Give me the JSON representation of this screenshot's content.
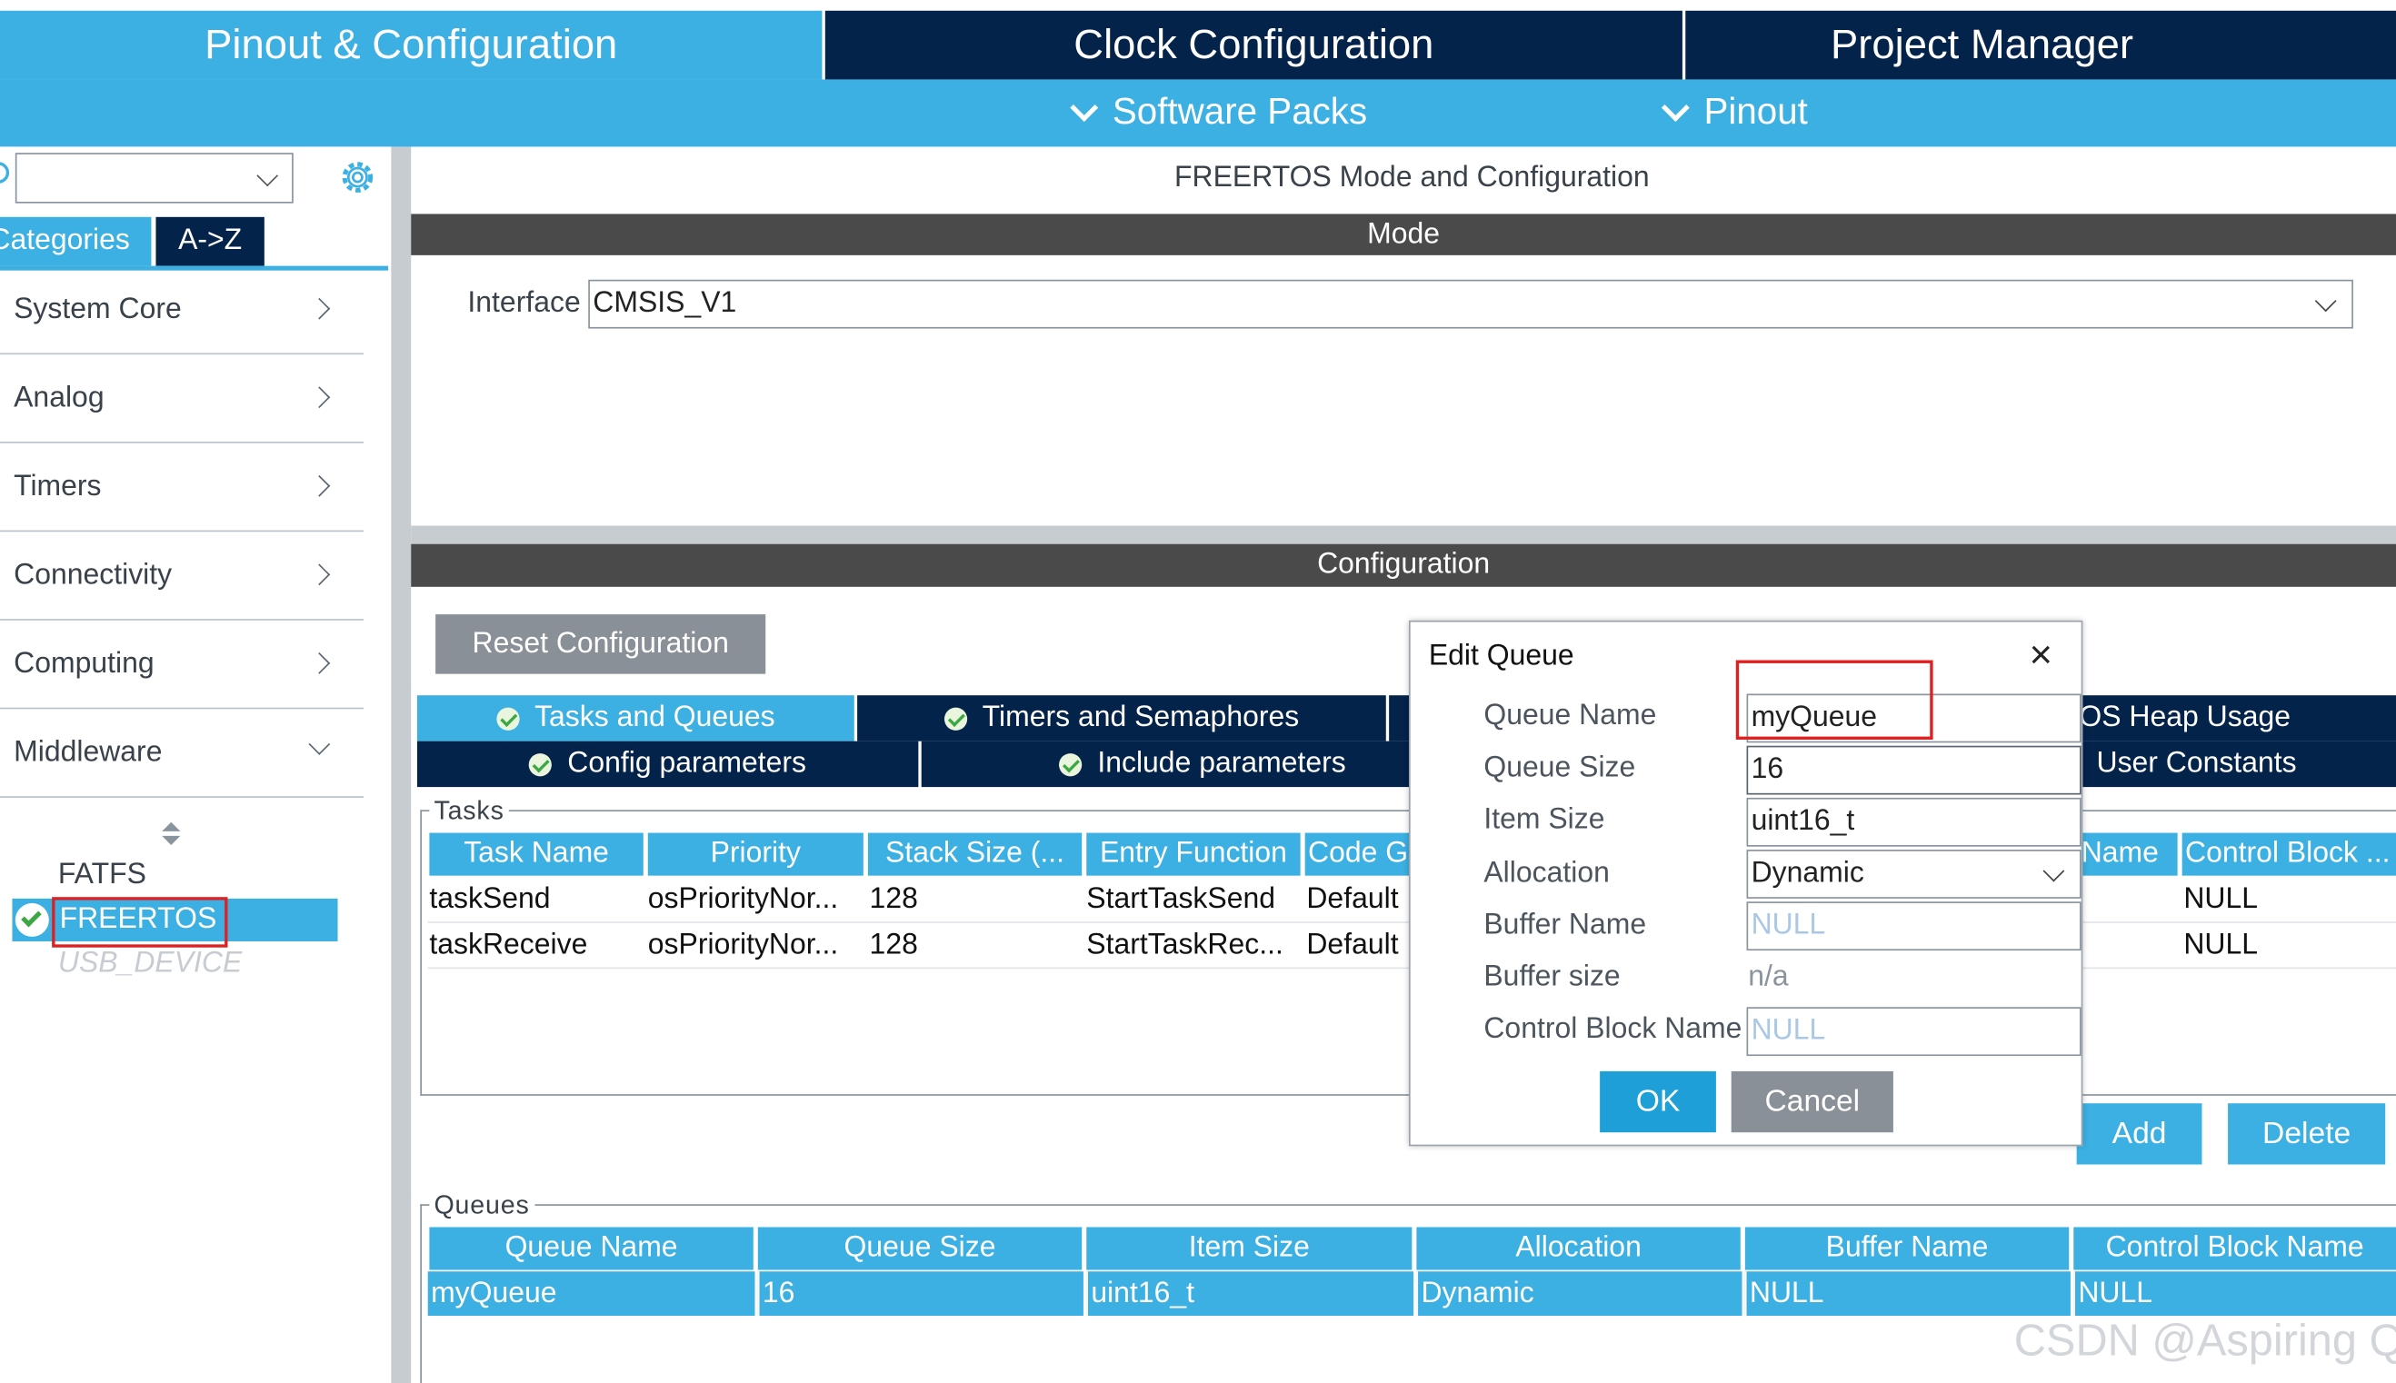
{
  "top_tabs": {
    "pinout": "Pinout & Configuration",
    "clock": "Clock Configuration",
    "project": "Project Manager"
  },
  "sub_menu": {
    "software_packs": "Software Packs",
    "pinout": "Pinout"
  },
  "sidebar": {
    "search_placeholder": "",
    "tab_categories": "Categories",
    "tab_az": "A->Z",
    "categories": [
      "System Core",
      "Analog",
      "Timers",
      "Connectivity",
      "Computing",
      "Middleware"
    ],
    "middleware_items": [
      "FATFS",
      "FREERTOS",
      "USB_DEVICE"
    ]
  },
  "main": {
    "title": "FREERTOS Mode and Configuration",
    "mode_header": "Mode",
    "interface_label": "Interface",
    "interface_value": "CMSIS_V1",
    "config_header": "Configuration",
    "reset_button": "Reset Configuration",
    "tabs_row1": [
      "Tasks and Queues",
      "Timers and Semaphores",
      "RTOS Heap Usage"
    ],
    "tabs_row2": [
      "Config parameters",
      "Include parameters",
      "User Constants"
    ],
    "tasks_group": "Tasks",
    "task_columns": [
      "Task Name",
      "Priority",
      "Stack Size (...",
      "Entry Function",
      "Code G",
      "Name",
      "Control Block ..."
    ],
    "task_rows": [
      [
        "taskSend",
        "osPriorityNor...",
        "128",
        "StartTaskSend",
        "Default",
        "NULL"
      ],
      [
        "taskReceive",
        "osPriorityNor...",
        "128",
        "StartTaskRec...",
        "Default",
        "NULL"
      ]
    ],
    "add_button": "Add",
    "delete_button": "Delete",
    "queues_group": "Queues",
    "queue_columns": [
      "Queue Name",
      "Queue Size",
      "Item Size",
      "Allocation",
      "Buffer Name",
      "Control Block Name"
    ],
    "queue_row": [
      "myQueue",
      "16",
      "uint16_t",
      "Dynamic",
      "NULL",
      "NULL"
    ]
  },
  "dialog": {
    "title": "Edit Queue",
    "close": "×",
    "labels": [
      "Queue Name",
      "Queue Size",
      "Item Size",
      "Allocation",
      "Buffer Name",
      "Buffer size",
      "Control Block Name"
    ],
    "queue_name": "myQueue",
    "queue_size": "16",
    "item_size": "uint16_t",
    "allocation": "Dynamic",
    "buffer_name": "NULL",
    "buffer_size": "n/a",
    "control_block_name": "NULL",
    "ok": "OK",
    "cancel": "Cancel"
  },
  "watermark": "CSDN @Aspiring Q",
  "colors": {
    "dark_navy": "#03234b",
    "accent_blue": "#3cb0e2",
    "gray_header": "#4a4a4a",
    "highlight_red": "#e02020",
    "ok_blue": "#1e9fd8",
    "cancel_gray": "#8a9097"
  }
}
